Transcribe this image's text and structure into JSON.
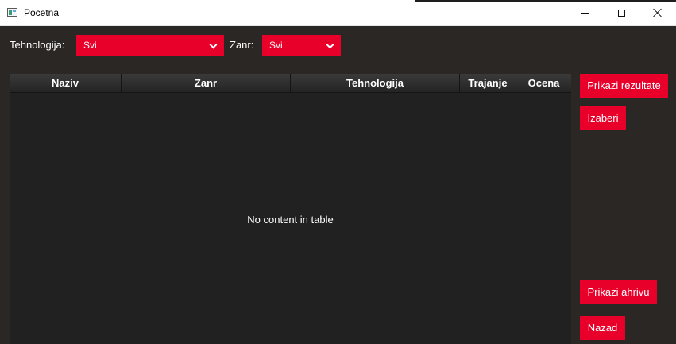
{
  "window": {
    "title": "Pocetna",
    "controls": {
      "minimize": "minimize",
      "maximize": "maximize",
      "close": "close"
    }
  },
  "filters": {
    "technology_label": "Tehnologija:",
    "technology_value": "Svi",
    "genre_label": "Zanr:",
    "genre_value": "Svi"
  },
  "table": {
    "columns": [
      "Naziv",
      "Zanr",
      "Tehnologija",
      "Trajanje",
      "Ocena"
    ],
    "rows": [],
    "empty_text": "No content in table"
  },
  "actions": {
    "show_results": "Prikazi rezultate",
    "choose": "Izaberi",
    "show_archive": "Prikazi ahrivu",
    "back": "Nazad"
  },
  "colors": {
    "accent": "#e8002a",
    "background": "#2b2725",
    "table_background": "#212121",
    "text": "#ffffff"
  },
  "icons": {
    "app": "app-window-icon",
    "dropdown": "chevron-down-icon"
  }
}
